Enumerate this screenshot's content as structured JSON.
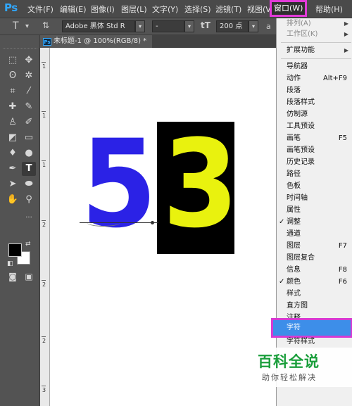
{
  "app": {
    "logo": "Ps"
  },
  "menubar": {
    "items": [
      {
        "label": "文件(F)"
      },
      {
        "label": "编辑(E)"
      },
      {
        "label": "图像(I)"
      },
      {
        "label": "图层(L)"
      },
      {
        "label": "文字(Y)"
      },
      {
        "label": "选择(S)"
      },
      {
        "label": "滤镜(T)"
      },
      {
        "label": "视图(V)"
      },
      {
        "label": "窗口(W)"
      },
      {
        "label": "帮助(H)"
      }
    ],
    "active_index": 8
  },
  "options": {
    "font_family": "Adobe 黑体 Std R",
    "font_style": "-",
    "font_size": "200 点",
    "aa_label": "a"
  },
  "document": {
    "tab_title": "未标题-1 @ 100%(RGB/8) *"
  },
  "ruler": {
    "numbers": [
      "1",
      "1",
      "1",
      "2",
      "2",
      "2",
      "3"
    ]
  },
  "canvas": {
    "digit_left": "5",
    "digit_right": "3",
    "colors": {
      "left_digit": "#2b22e6",
      "right_digit": "#e9f20e",
      "right_box": "#000000"
    }
  },
  "window_menu": {
    "items": [
      {
        "label": "排列(A)",
        "disabled": true,
        "submenu": true
      },
      {
        "label": "工作区(K)",
        "disabled": true,
        "submenu": true
      },
      {
        "label": "扩展功能",
        "submenu": true
      },
      {
        "label": "导航器"
      },
      {
        "label": "动作",
        "shortcut": "Alt+F9"
      },
      {
        "label": "段落"
      },
      {
        "label": "段落样式"
      },
      {
        "label": "仿制源"
      },
      {
        "label": "工具预设"
      },
      {
        "label": "画笔",
        "shortcut": "F5"
      },
      {
        "label": "画笔预设"
      },
      {
        "label": "历史记录"
      },
      {
        "label": "路径"
      },
      {
        "label": "色板"
      },
      {
        "label": "时间轴"
      },
      {
        "label": "属性"
      },
      {
        "label": "调整",
        "checked": true
      },
      {
        "label": "通道"
      },
      {
        "label": "图层",
        "shortcut": "F7"
      },
      {
        "label": "图层复合"
      },
      {
        "label": "信息",
        "shortcut": "F8"
      },
      {
        "label": "颜色",
        "shortcut": "F6",
        "checked": true
      },
      {
        "label": "样式"
      },
      {
        "label": "直方图"
      },
      {
        "label": "注释"
      },
      {
        "label": "字符",
        "highlighted": true
      },
      {
        "label": "字符样式"
      }
    ]
  },
  "watermark": {
    "title": "百科全说",
    "subtitle": "助你轻松解决"
  },
  "accent_colors": {
    "highlight": "#3d8ee9",
    "outline": "#d63ad2"
  }
}
